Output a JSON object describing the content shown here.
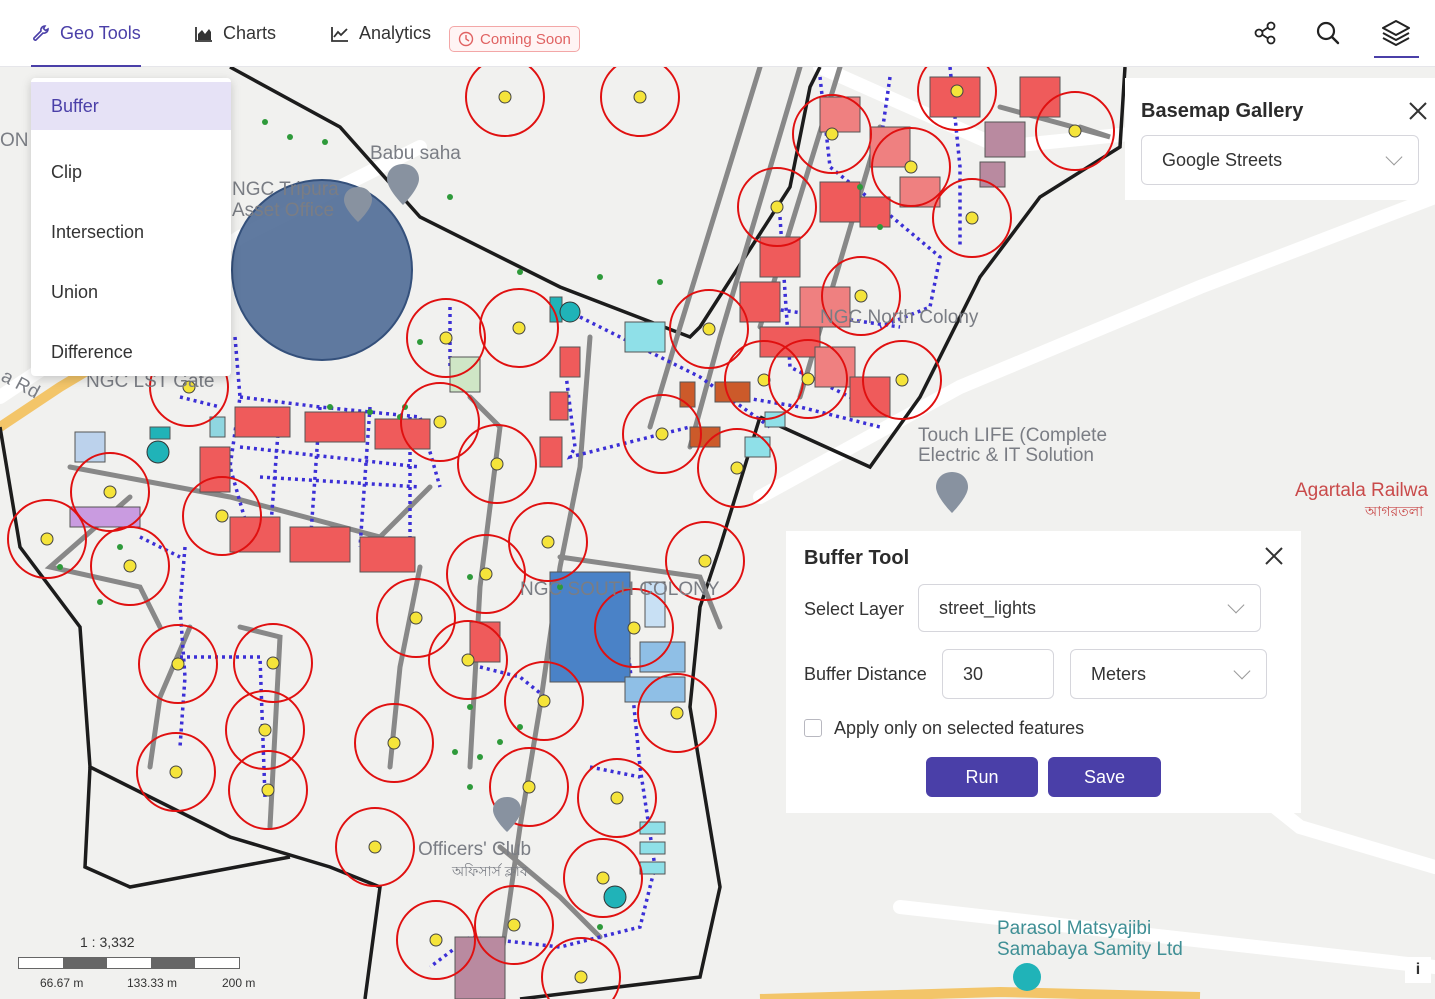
{
  "nav": {
    "tabs": [
      {
        "label": "Geo Tools",
        "icon": "wrench-icon",
        "active": true
      },
      {
        "label": "Charts",
        "icon": "area-chart-icon"
      },
      {
        "label": "Analytics",
        "icon": "line-chart-icon"
      }
    ],
    "coming_soon": "Coming Soon",
    "right_icons": [
      "share-icon",
      "search-icon",
      "layers-icon"
    ],
    "accent": "#4a3fa8"
  },
  "geo_tools_menu": {
    "items": [
      "Buffer",
      "Clip",
      "Intersection",
      "Union",
      "Difference"
    ],
    "selected": "Buffer"
  },
  "basemap_gallery": {
    "title": "Basemap Gallery",
    "selected": "Google Streets"
  },
  "buffer_tool": {
    "title": "Buffer Tool",
    "select_layer_label": "Select Layer",
    "layer_value": "street_lights",
    "buffer_distance_label": "Buffer Distance",
    "distance_value": "30",
    "unit_value": "Meters",
    "checkbox_label": "Apply only on selected features",
    "checkbox_checked": false,
    "run_label": "Run",
    "save_label": "Save"
  },
  "map_labels": {
    "babu_saha": "Babu saha",
    "ongc_tripura_1": "NGC Tripura",
    "ongc_tripura_2": "Asset Office",
    "ongc_north": "NGC North Colony",
    "touch_life_1": "Touch LIFE (Complete",
    "touch_life_2": "Electric & IT Solution",
    "agartala_rail": "Agartala Railwa",
    "agartala_bn": "আগরতলা",
    "south_colony": "NGC SOUTH COLONY",
    "officers_club": "Officers' Club",
    "officers_club_bn": "অফিসার্স ক্লাব",
    "parasol_1": "Parasol Matsyajibi",
    "parasol_2": "Samabaya Samity Ltd",
    "ongc_lst": "NGC LST Gate",
    "rd": "a Rd",
    "on": "ON"
  },
  "scale": {
    "ratio": "1 : 3,332",
    "ticks": [
      "66.67 m",
      "133.33 m",
      "200 m"
    ]
  },
  "info_label": "i",
  "colors": {
    "buffer_ring": "#e01010",
    "street_light": "#f5e43a",
    "building": "#ef5b5b",
    "road_outline": "#1c1c1c",
    "network": "#3b2fd6"
  }
}
